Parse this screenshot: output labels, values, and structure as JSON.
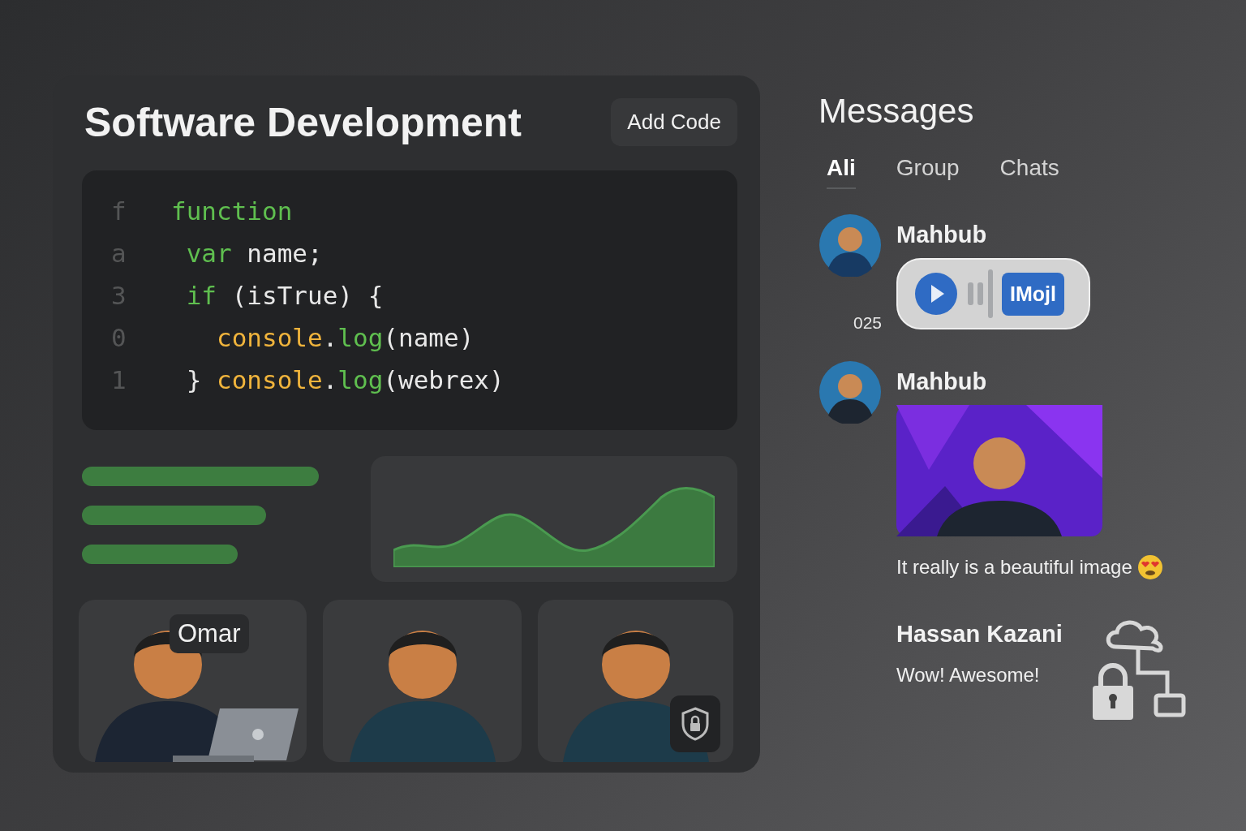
{
  "editor": {
    "title": "Software Development",
    "add_button": "Add Code",
    "code_lines": [
      {
        "gutter": "f",
        "tokens": [
          {
            "kind": "keyword",
            "text": "function"
          }
        ]
      },
      {
        "gutter": "a",
        "tokens": [
          {
            "kind": "keyword",
            "text": " var"
          },
          {
            "kind": "plain",
            "text": " name;"
          }
        ]
      },
      {
        "gutter": "3",
        "tokens": [
          {
            "kind": "keyword",
            "text": " if"
          },
          {
            "kind": "plain",
            "text": " (isTrue) {"
          }
        ]
      },
      {
        "gutter": "0",
        "tokens": [
          {
            "kind": "object",
            "text": "   console"
          },
          {
            "kind": "plain",
            "text": "."
          },
          {
            "kind": "keyword",
            "text": "log"
          },
          {
            "kind": "plain",
            "text": "(name)"
          }
        ]
      },
      {
        "gutter": "1",
        "tokens": [
          {
            "kind": "plain",
            "text": " } "
          },
          {
            "kind": "object",
            "text": "console"
          },
          {
            "kind": "plain",
            "text": "."
          },
          {
            "kind": "keyword",
            "text": "log"
          },
          {
            "kind": "plain",
            "text": "(webrex)"
          }
        ]
      }
    ],
    "participants": [
      {
        "name": "Omar",
        "kind": "laptop"
      },
      {
        "kind": "plain"
      },
      {
        "kind": "shield"
      }
    ]
  },
  "messages": {
    "title": "Messages",
    "tabs": [
      {
        "label": "Ali",
        "selected": true
      },
      {
        "label": "Group",
        "selected": false
      },
      {
        "label": "Chats",
        "selected": false
      }
    ],
    "items": [
      {
        "kind": "voice",
        "sender": "Mahbub",
        "time": "025",
        "badge": "IMojl"
      },
      {
        "kind": "image",
        "sender": "Mahbub",
        "caption": "It really is a beautiful image"
      },
      {
        "kind": "text",
        "sender": "Hassan Kazani",
        "text": "Wow! Awesome!"
      }
    ]
  }
}
